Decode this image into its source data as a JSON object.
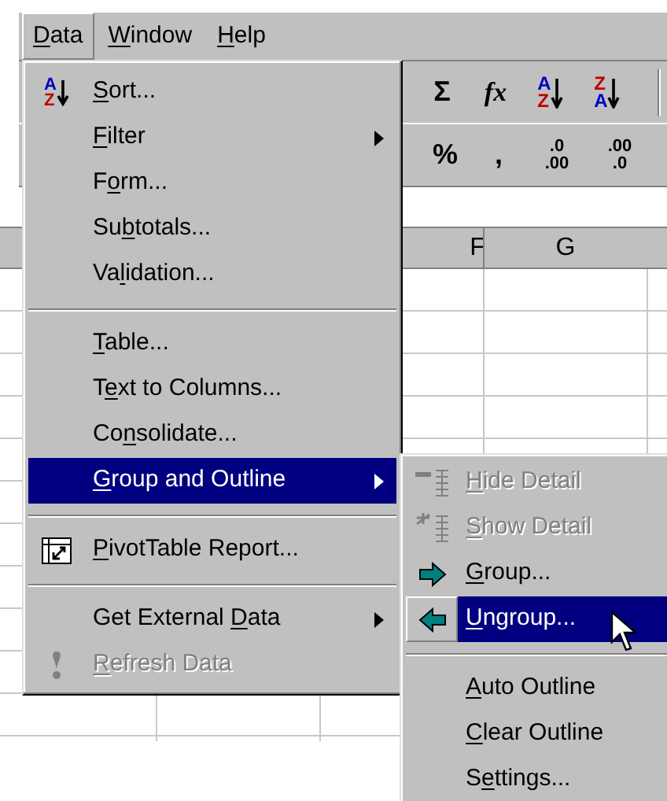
{
  "menu_bar": [
    {
      "key": "D",
      "post": "ata",
      "selected": true
    },
    {
      "key": "W",
      "post": "indow",
      "selected": false
    },
    {
      "key": "H",
      "post": "elp",
      "selected": false
    }
  ],
  "toolbar_1": [
    {
      "kind": "glyph",
      "text": "Σ"
    },
    {
      "kind": "function",
      "text": "fx"
    },
    {
      "kind": "sort",
      "top": "A",
      "bottom": "Z"
    },
    {
      "kind": "sort",
      "top": "Z",
      "bottom": "A"
    }
  ],
  "toolbar_2": [
    {
      "kind": "glyph",
      "text": "%"
    },
    {
      "kind": "glyph",
      "text": ","
    },
    {
      "kind": "decimal",
      "top": ".0",
      "bottom": ".00"
    },
    {
      "kind": "decimal",
      "top": ".00",
      "bottom": ".0"
    }
  ],
  "column_headers": [
    "F",
    "G"
  ],
  "data_menu": [
    {
      "kind": "sort",
      "icon_letters": [
        "A",
        "Z"
      ],
      "key": "S",
      "post": "ort...",
      "selected": false,
      "disabled": false,
      "submenu": false
    },
    {
      "kind": "plain",
      "key": "F",
      "post": "ilter",
      "selected": false,
      "disabled": false,
      "submenu": true
    },
    {
      "kind": "plain",
      "pre": "F",
      "key": "o",
      "post": "rm...",
      "selected": false,
      "disabled": false,
      "submenu": false
    },
    {
      "kind": "plain",
      "pre": "Su",
      "key": "b",
      "post": "totals...",
      "selected": false,
      "disabled": false,
      "submenu": false
    },
    {
      "kind": "plain",
      "pre": "Va",
      "key": "l",
      "post": "idation...",
      "selected": false,
      "disabled": false,
      "submenu": false
    },
    {
      "kind": "separator"
    },
    {
      "kind": "plain",
      "key": "T",
      "post": "able...",
      "selected": false,
      "disabled": false,
      "submenu": false
    },
    {
      "kind": "plain",
      "pre": "T",
      "key": "e",
      "post": "xt to Columns...",
      "selected": false,
      "disabled": false,
      "submenu": false
    },
    {
      "kind": "plain",
      "pre": "Co",
      "key": "n",
      "post": "solidate...",
      "selected": false,
      "disabled": false,
      "submenu": false
    },
    {
      "kind": "plain",
      "key": "G",
      "post": "roup and Outline",
      "selected": true,
      "disabled": false,
      "submenu": true
    },
    {
      "kind": "separator"
    },
    {
      "kind": "pivot",
      "key": "P",
      "post": "ivotTable Report...",
      "selected": false,
      "disabled": false,
      "submenu": false
    },
    {
      "kind": "separator"
    },
    {
      "kind": "plain",
      "pre": "Get External ",
      "key": "D",
      "post": "ata",
      "selected": false,
      "disabled": false,
      "submenu": true
    },
    {
      "kind": "refresh",
      "key": "R",
      "post": "efresh Data",
      "selected": false,
      "disabled": true,
      "submenu": false
    }
  ],
  "group_submenu": [
    {
      "kind": "hide-detail",
      "key": "H",
      "post": "ide Detail",
      "selected": false,
      "disabled": true
    },
    {
      "kind": "show-detail",
      "key": "S",
      "post": "how Detail",
      "selected": false,
      "disabled": true
    },
    {
      "kind": "group",
      "key": "G",
      "post": "roup...",
      "selected": false,
      "disabled": false
    },
    {
      "kind": "ungroup",
      "key": "U",
      "post": "ngroup...",
      "selected": true,
      "disabled": false
    },
    {
      "kind": "separator"
    },
    {
      "kind": "plain",
      "key": "A",
      "post": "uto Outline",
      "selected": false,
      "disabled": false
    },
    {
      "kind": "plain",
      "key": "C",
      "post": "lear Outline",
      "selected": false,
      "disabled": false
    },
    {
      "kind": "plain",
      "pre": "S",
      "key": "e",
      "post": "ttings...",
      "selected": false,
      "disabled": false
    }
  ]
}
